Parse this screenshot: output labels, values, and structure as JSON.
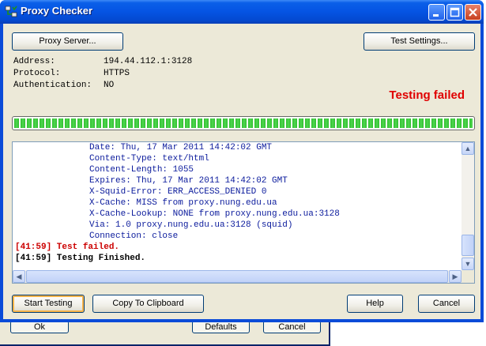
{
  "background_dialog": {
    "ok_label": "Ok",
    "defaults_label": "Defaults",
    "cancel_label": "Cancel"
  },
  "window": {
    "title": "Proxy Checker",
    "icons": {
      "app": "proxy-checker-app-icon",
      "minimize": "minimize-icon",
      "maximize": "maximize-icon",
      "close": "close-icon"
    }
  },
  "toolbar": {
    "proxy_server_label": "Proxy Server...",
    "test_settings_label": "Test Settings..."
  },
  "info": {
    "address_label": "Address:",
    "address_value": "194.44.112.1:3128",
    "protocol_label": "Protocol:",
    "protocol_value": "HTTPS",
    "auth_label": "Authentication:",
    "auth_value": "NO"
  },
  "status": {
    "text": "Testing failed",
    "color": "#e00000"
  },
  "progress": {
    "percent": 100,
    "color": "#2fbe2f"
  },
  "log": {
    "lines": [
      "Date: Thu, 17 Mar 2011 14:42:02 GMT",
      "Content-Type: text/html",
      "Content-Length: 1055",
      "Expires: Thu, 17 Mar 2011 14:42:02 GMT",
      "X-Squid-Error: ERR_ACCESS_DENIED 0",
      "X-Cache: MISS from proxy.nung.edu.ua",
      "X-Cache-Lookup: NONE from proxy.nung.edu.ua:3128",
      "Via: 1.0 proxy.nung.edu.ua:3128 (squid)",
      "Connection: close"
    ],
    "fail_line": "[41:59] Test failed.",
    "finished_line": "[41:59] Testing Finished."
  },
  "buttons": {
    "start_testing": "Start Testing",
    "copy_to_clipboard": "Copy To Clipboard",
    "help": "Help",
    "cancel": "Cancel"
  }
}
